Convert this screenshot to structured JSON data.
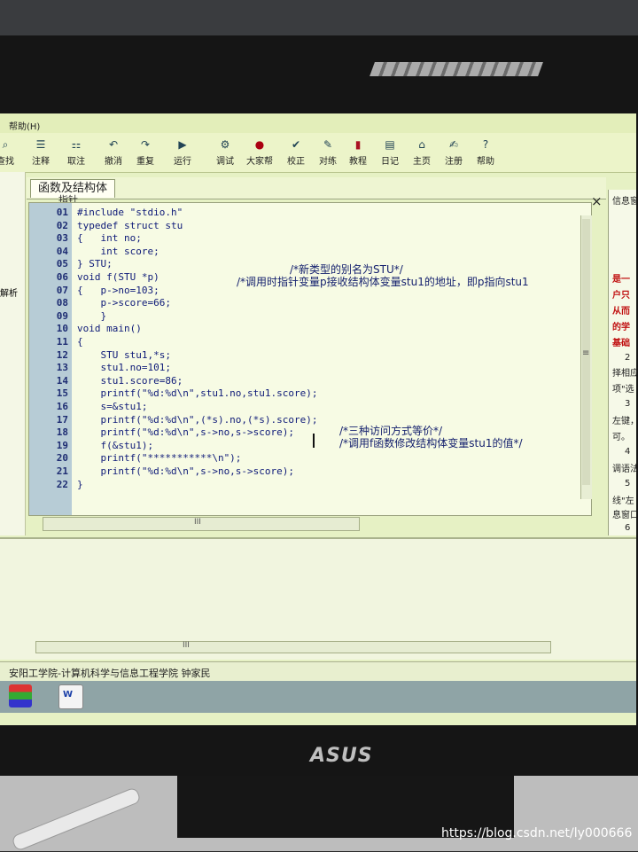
{
  "menubar": {
    "help": "帮助(H)"
  },
  "toolbar": {
    "items": [
      {
        "label": "查找",
        "icon": "search-icon"
      },
      {
        "label": "注释",
        "icon": "comment-icon"
      },
      {
        "label": "取注",
        "icon": "uncomment-icon"
      },
      {
        "label": "撤消",
        "icon": "undo-icon"
      },
      {
        "label": "重复",
        "icon": "redo-icon"
      },
      {
        "label": "运行",
        "icon": "run-icon"
      },
      {
        "label": "调试",
        "icon": "debug-icon"
      },
      {
        "label": "大家帮",
        "icon": "help-people-icon"
      },
      {
        "label": "校正",
        "icon": "check-icon"
      },
      {
        "label": "对练",
        "icon": "practice-icon"
      },
      {
        "label": "教程",
        "icon": "book-icon"
      },
      {
        "label": "日记",
        "icon": "diary-icon"
      },
      {
        "label": "主页",
        "icon": "home-icon"
      },
      {
        "label": "注册",
        "icon": "register-icon"
      },
      {
        "label": "帮助",
        "icon": "question-icon"
      }
    ]
  },
  "left_panel": {
    "label": "解析"
  },
  "editor": {
    "tab_label": "函数及结构体",
    "tab_sub": "指针",
    "close": "×",
    "lines": [
      {
        "no": "01",
        "code": "#include \"stdio.h\""
      },
      {
        "no": "02",
        "code": "typedef struct stu"
      },
      {
        "no": "03",
        "code": "{   int no;"
      },
      {
        "no": "04",
        "code": "    int score;"
      },
      {
        "no": "05",
        "code": "} STU;"
      },
      {
        "no": "06",
        "code": "void f(STU *p)"
      },
      {
        "no": "07",
        "code": "{   p->no=103;"
      },
      {
        "no": "08",
        "code": "    p->score=66;"
      },
      {
        "no": "09",
        "code": "    }"
      },
      {
        "no": "10",
        "code": "void main()"
      },
      {
        "no": "11",
        "code": "{"
      },
      {
        "no": "12",
        "code": "    STU stu1,*s;"
      },
      {
        "no": "13",
        "code": "    stu1.no=101;"
      },
      {
        "no": "14",
        "code": "    stu1.score=86;"
      },
      {
        "no": "15",
        "code": "    printf(\"%d:%d\\n\",stu1.no,stu1.score);"
      },
      {
        "no": "16",
        "code": "    s=&stu1;"
      },
      {
        "no": "17",
        "code": "    printf(\"%d:%d\\n\",(*s).no,(*s).score);"
      },
      {
        "no": "18",
        "code": "    printf(\"%d:%d\\n\",s->no,s->score);"
      },
      {
        "no": "19",
        "code": "    f(&stu1);"
      },
      {
        "no": "20",
        "code": "    printf(\"***********\\n\");"
      },
      {
        "no": "21",
        "code": "    printf(\"%d:%d\\n\",s->no,s->score);"
      },
      {
        "no": "22",
        "code": "}"
      }
    ],
    "comments": {
      "c1": "/*新类型的别名为STU*/",
      "c2": "/*调用时指针变量p接收结构体变量stu1的地址，即p指向stu1",
      "c3": "/*三种访问方式等价*/",
      "c4": "/*调用f函数修改结构体变量stu1的值*/"
    },
    "scroll_grip": "III",
    "vscroll_grip": "≡"
  },
  "info_panel": {
    "title": "信息窗",
    "lines": [
      "是一",
      "户只",
      "从而",
      "的学",
      "基础",
      "2",
      "择相应",
      "项\"选",
      "3",
      "左键，",
      "可。",
      "4",
      "调语法",
      "5",
      "线\"左",
      "息窗口",
      "6"
    ]
  },
  "status_bar": {
    "text": "安阳工学院-计算机科学与信息工程学院    钟家民"
  },
  "monitor": {
    "brand": "ASUS"
  },
  "watermark": "https://blog.csdn.net/ly000666"
}
